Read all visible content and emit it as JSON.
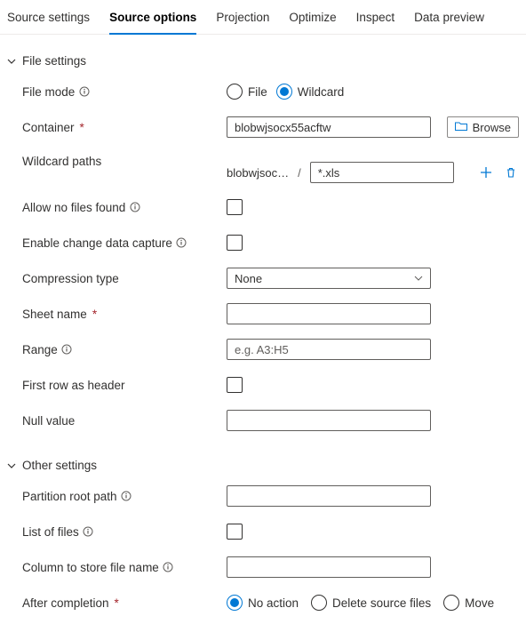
{
  "tabs": {
    "source_settings": "Source settings",
    "source_options": "Source options",
    "projection": "Projection",
    "optimize": "Optimize",
    "inspect": "Inspect",
    "data_preview": "Data preview"
  },
  "sections": {
    "file_settings": "File settings",
    "other_settings": "Other settings"
  },
  "labels": {
    "file_mode": "File mode",
    "container": "Container",
    "wildcard_paths": "Wildcard paths",
    "allow_no_files": "Allow no files found",
    "enable_cdc": "Enable change data capture",
    "compression_type": "Compression type",
    "sheet_name": "Sheet name",
    "range": "Range",
    "first_row_header": "First row as header",
    "null_value": "Null value",
    "partition_root": "Partition root path",
    "list_of_files": "List of files",
    "column_filename": "Column to store file name",
    "after_completion": "After completion"
  },
  "file_mode": {
    "file": "File",
    "wildcard": "Wildcard",
    "selected": "wildcard"
  },
  "container": {
    "value": "blobwjsocx55acftw",
    "browse": "Browse"
  },
  "wildcard": {
    "prefix": "blobwjsoc…",
    "value": "*.xls"
  },
  "compression": {
    "value": "None"
  },
  "range": {
    "placeholder": "e.g. A3:H5"
  },
  "after_completion": {
    "no_action": "No action",
    "delete": "Delete source files",
    "move": "Move",
    "selected": "no_action"
  },
  "req": "*"
}
